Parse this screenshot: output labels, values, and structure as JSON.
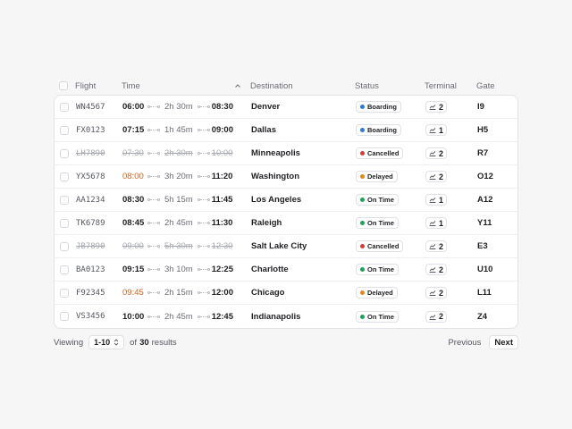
{
  "headers": {
    "flight": "Flight",
    "time": "Time",
    "destination": "Destination",
    "status": "Status",
    "terminal": "Terminal",
    "gate": "Gate"
  },
  "colors": {
    "boarding": "#2f7ad8",
    "cancelled": "#d93c3c",
    "delayed": "#e08a1e",
    "on_time": "#1fa35c"
  },
  "rows": [
    {
      "flight": "WN4567",
      "dep": "06:00",
      "dur": "2h 30m",
      "arr": "08:30",
      "dest": "Denver",
      "status": "Boarding",
      "status_key": "boarding",
      "terminal": "2",
      "gate": "I9"
    },
    {
      "flight": "FX0123",
      "dep": "07:15",
      "dur": "1h 45m",
      "arr": "09:00",
      "dest": "Dallas",
      "status": "Boarding",
      "status_key": "boarding",
      "terminal": "1",
      "gate": "H5"
    },
    {
      "flight": "LH7890",
      "dep": "07:30",
      "dur": "2h 30m",
      "arr": "10:00",
      "dest": "Minneapolis",
      "status": "Cancelled",
      "status_key": "cancelled",
      "terminal": "2",
      "gate": "R7"
    },
    {
      "flight": "YX5678",
      "dep": "08:00",
      "dur": "3h 20m",
      "arr": "11:20",
      "dest": "Washington",
      "status": "Delayed",
      "status_key": "delayed",
      "terminal": "2",
      "gate": "O12"
    },
    {
      "flight": "AA1234",
      "dep": "08:30",
      "dur": "5h 15m",
      "arr": "11:45",
      "dest": "Los Angeles",
      "status": "On Time",
      "status_key": "on_time",
      "terminal": "1",
      "gate": "A12"
    },
    {
      "flight": "TK6789",
      "dep": "08:45",
      "dur": "2h 45m",
      "arr": "11:30",
      "dest": "Raleigh",
      "status": "On Time",
      "status_key": "on_time",
      "terminal": "1",
      "gate": "Y11"
    },
    {
      "flight": "JB7890",
      "dep": "09:00",
      "dur": "5h 30m",
      "arr": "12:30",
      "dest": "Salt Lake City",
      "status": "Cancelled",
      "status_key": "cancelled",
      "terminal": "2",
      "gate": "E3"
    },
    {
      "flight": "BA0123",
      "dep": "09:15",
      "dur": "3h 10m",
      "arr": "12:25",
      "dest": "Charlotte",
      "status": "On Time",
      "status_key": "on_time",
      "terminal": "2",
      "gate": "U10"
    },
    {
      "flight": "F92345",
      "dep": "09:45",
      "dur": "2h 15m",
      "arr": "12:00",
      "dest": "Chicago",
      "status": "Delayed",
      "status_key": "delayed",
      "terminal": "2",
      "gate": "L11"
    },
    {
      "flight": "VS3456",
      "dep": "10:00",
      "dur": "2h 45m",
      "arr": "12:45",
      "dest": "Indianapolis",
      "status": "On Time",
      "status_key": "on_time",
      "terminal": "2",
      "gate": "Z4"
    }
  ],
  "footer": {
    "viewing_label": "Viewing",
    "range": "1-10",
    "of_label": "of",
    "total": "30",
    "results_label": "results",
    "previous": "Previous",
    "next": "Next"
  }
}
